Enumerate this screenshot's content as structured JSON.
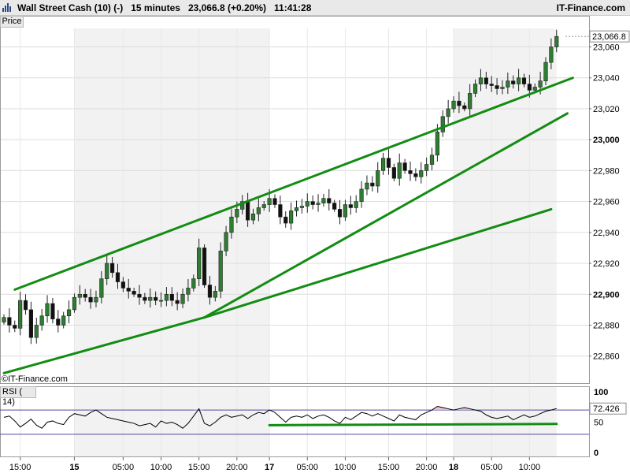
{
  "header": {
    "title": "Wall Street Cash (10) (-)   15 minutes   23,066.8 (+0.20%)   11:41:28",
    "brand": "IT-Finance.com"
  },
  "price_panel": {
    "label": "Price",
    "watermark": "©IT-Finance.com",
    "last_price_label": "23,066.8"
  },
  "rsi_panel": {
    "label": "RSI ( 14)",
    "value_label": "72.426",
    "yticks": [
      "100",
      "50",
      "0"
    ]
  },
  "colors": {
    "up": "#2e7d32",
    "down": "#111111",
    "trendline": "#138c13",
    "rsi_line": "#000000",
    "rsi_overbought": "#4a4aa0",
    "session_shade": "#f2f2f2"
  },
  "chart_data": [
    {
      "type": "candlestick",
      "instrument": "Wall Street Cash (10) (-)",
      "timeframe": "15 minutes",
      "last": 23066.8,
      "change_pct": 0.2,
      "ylim": [
        22842,
        23072
      ],
      "yticks": [
        {
          "value": 22860,
          "label": "22,860",
          "major": false
        },
        {
          "value": 22880,
          "label": "22,880",
          "major": false
        },
        {
          "value": 22900,
          "label": "22,900",
          "major": true
        },
        {
          "value": 22920,
          "label": "22,920",
          "major": false
        },
        {
          "value": 22940,
          "label": "22,940",
          "major": false
        },
        {
          "value": 22960,
          "label": "22,960",
          "major": false
        },
        {
          "value": 22980,
          "label": "22,980",
          "major": false
        },
        {
          "value": 23000,
          "label": "23,000",
          "major": true
        },
        {
          "value": 23020,
          "label": "23,020",
          "major": false
        },
        {
          "value": 23040,
          "label": "23,040",
          "major": false
        },
        {
          "value": 23060,
          "label": "23,060",
          "major": false
        }
      ],
      "xticks": [
        {
          "bar": 3,
          "label": "15:00",
          "major": false
        },
        {
          "bar": 13,
          "label": "15",
          "major": true
        },
        {
          "bar": 22,
          "label": "05:00",
          "major": false
        },
        {
          "bar": 29,
          "label": "10:00",
          "major": false
        },
        {
          "bar": 36,
          "label": "15:00",
          "major": false
        },
        {
          "bar": 43,
          "label": "20:00",
          "major": false
        },
        {
          "bar": 49,
          "label": "17",
          "major": true
        },
        {
          "bar": 56,
          "label": "05:00",
          "major": false
        },
        {
          "bar": 63,
          "label": "10:00",
          "major": false
        },
        {
          "bar": 71,
          "label": "15:00",
          "major": false
        },
        {
          "bar": 78,
          "label": "20:00",
          "major": false
        },
        {
          "bar": 83,
          "label": "18",
          "major": true
        },
        {
          "bar": 90,
          "label": "05:00",
          "major": false
        },
        {
          "bar": 97,
          "label": "10:00",
          "major": false
        }
      ],
      "session_shading": [
        [
          13,
          49
        ],
        [
          83,
          102
        ]
      ],
      "closes": [
        22885,
        22880,
        22878,
        22896,
        22890,
        22872,
        22880,
        22886,
        22894,
        22884,
        22880,
        22886,
        22890,
        22898,
        22900,
        22898,
        22895,
        22898,
        22910,
        22920,
        22914,
        22908,
        22904,
        22902,
        22900,
        22898,
        22896,
        22898,
        22896,
        22896,
        22900,
        22896,
        22894,
        22900,
        22904,
        22910,
        22930,
        22906,
        22898,
        22902,
        22928,
        22940,
        22950,
        22955,
        22960,
        22948,
        22952,
        22956,
        22958,
        22962,
        22958,
        22950,
        22946,
        22954,
        22956,
        22957,
        22960,
        22958,
        22959,
        22962,
        22959,
        22955,
        22950,
        22958,
        22956,
        22960,
        22968,
        22972,
        22970,
        22980,
        22988,
        22982,
        22975,
        22985,
        22980,
        22978,
        22976,
        22980,
        22984,
        22990,
        23005,
        23015,
        23020,
        23025,
        23022,
        23020,
        23030,
        23036,
        23040,
        23036,
        23035,
        23033,
        23034,
        23038,
        23036,
        23040,
        23036,
        23032,
        23034,
        23038,
        23050,
        23060,
        23066.8
      ],
      "trendlines": [
        {
          "from": {
            "bar": 2,
            "value": 22903
          },
          "to": {
            "bar": 105,
            "value": 23040
          }
        },
        {
          "from": {
            "bar": 0,
            "value": 22849
          },
          "to": {
            "bar": 37,
            "value": 22885
          }
        },
        {
          "from": {
            "bar": 37,
            "value": 22885
          },
          "to": {
            "bar": 104,
            "value": 23017
          }
        },
        {
          "from": {
            "bar": 37,
            "value": 22885
          },
          "to": {
            "bar": 101,
            "value": 22955
          }
        }
      ]
    },
    {
      "type": "line",
      "indicator": "RSI (14)",
      "ylim": [
        0,
        100
      ],
      "overbought": 70,
      "oversold": 30,
      "last": 72.426,
      "values": [
        58,
        60,
        52,
        42,
        48,
        55,
        45,
        40,
        50,
        52,
        48,
        46,
        58,
        64,
        62,
        60,
        66,
        70,
        64,
        58,
        56,
        54,
        52,
        50,
        48,
        44,
        46,
        48,
        42,
        52,
        48,
        50,
        46,
        40,
        48,
        60,
        72,
        48,
        44,
        50,
        58,
        62,
        58,
        60,
        62,
        56,
        62,
        66,
        64,
        70,
        66,
        58,
        50,
        58,
        60,
        58,
        62,
        56,
        60,
        62,
        58,
        52,
        48,
        58,
        54,
        60,
        66,
        64,
        60,
        64,
        60,
        56,
        52,
        62,
        58,
        56,
        54,
        62,
        66,
        70,
        76,
        74,
        72,
        70,
        72,
        74,
        72,
        70,
        68,
        62,
        58,
        56,
        58,
        60,
        54,
        58,
        62,
        58,
        60,
        64,
        68,
        70,
        72.426
      ],
      "support_line": {
        "from": {
          "bar": 49,
          "value": 45
        },
        "to": {
          "bar": 102,
          "value": 47
        }
      }
    }
  ]
}
